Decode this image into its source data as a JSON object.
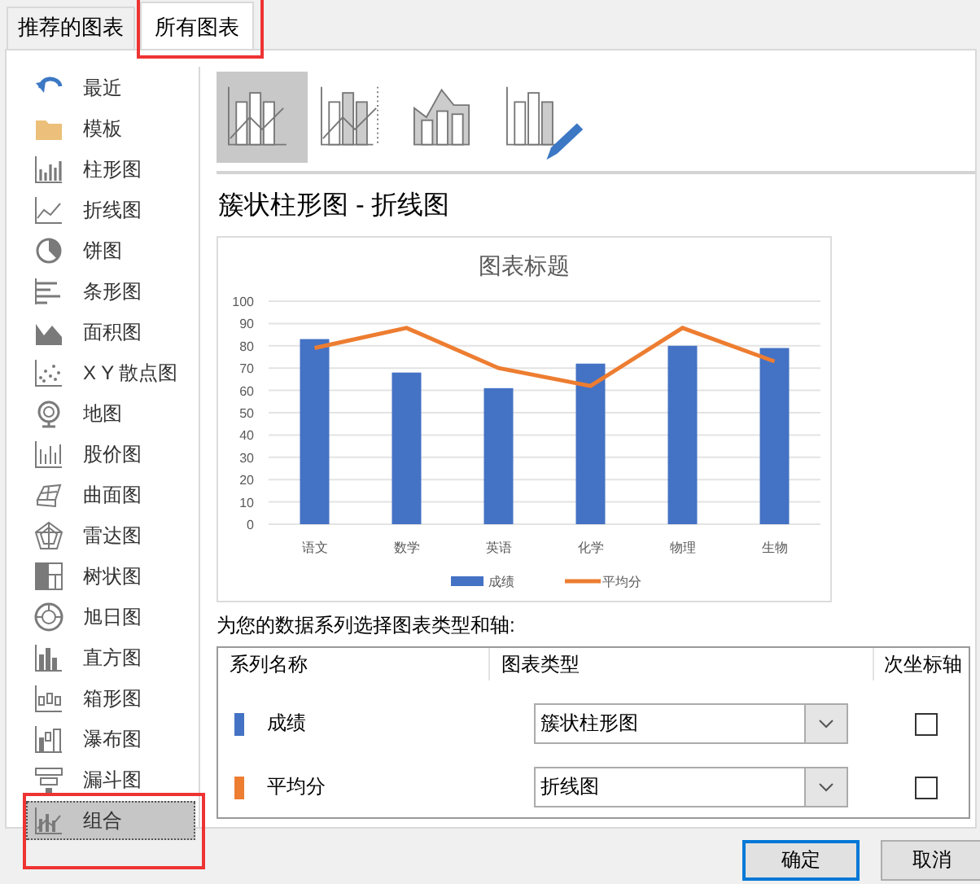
{
  "tabs": [
    {
      "label": "推荐的图表",
      "selected": false,
      "highlighted": false
    },
    {
      "label": "所有图表",
      "selected": true,
      "highlighted": true
    }
  ],
  "sidebar": {
    "items": [
      {
        "label": "最近",
        "selected": false,
        "highlighted": false
      },
      {
        "label": "模板",
        "selected": false,
        "highlighted": false
      },
      {
        "label": "柱形图",
        "selected": false,
        "highlighted": false
      },
      {
        "label": "折线图",
        "selected": false,
        "highlighted": false
      },
      {
        "label": "饼图",
        "selected": false,
        "highlighted": false
      },
      {
        "label": "条形图",
        "selected": false,
        "highlighted": false
      },
      {
        "label": "面积图",
        "selected": false,
        "highlighted": false
      },
      {
        "label": "X Y 散点图",
        "selected": false,
        "highlighted": false
      },
      {
        "label": "地图",
        "selected": false,
        "highlighted": false
      },
      {
        "label": "股价图",
        "selected": false,
        "highlighted": false
      },
      {
        "label": "曲面图",
        "selected": false,
        "highlighted": false
      },
      {
        "label": "雷达图",
        "selected": false,
        "highlighted": false
      },
      {
        "label": "树状图",
        "selected": false,
        "highlighted": false
      },
      {
        "label": "旭日图",
        "selected": false,
        "highlighted": false
      },
      {
        "label": "直方图",
        "selected": false,
        "highlighted": false
      },
      {
        "label": "箱形图",
        "selected": false,
        "highlighted": false
      },
      {
        "label": "瀑布图",
        "selected": false,
        "highlighted": false
      },
      {
        "label": "漏斗图",
        "selected": false,
        "highlighted": false
      },
      {
        "label": "组合",
        "selected": true,
        "highlighted": true
      }
    ]
  },
  "subtypes": [
    {
      "selected": true
    },
    {
      "selected": false
    },
    {
      "selected": false
    },
    {
      "selected": false
    }
  ],
  "chart_title": "簇状柱形图 - 折线图",
  "preview": {
    "chart_data": {
      "type": "bar",
      "title": "图表标题",
      "categories": [
        "语文",
        "数学",
        "英语",
        "化学",
        "物理",
        "生物"
      ],
      "series": [
        {
          "name": "成绩",
          "color": "#4472c4",
          "values": [
            83,
            68,
            61,
            72,
            80,
            79
          ]
        },
        {
          "name": "平均分",
          "color": "#ed7d31",
          "type": "line",
          "values": [
            79,
            88,
            70,
            62,
            88,
            73
          ]
        }
      ],
      "grid": true,
      "legend": "bottom",
      "ylim": [
        0,
        100
      ],
      "yticks": [
        0,
        10,
        20,
        30,
        40,
        50,
        60,
        70,
        80,
        90,
        100
      ]
    }
  },
  "series_prompt": "为您的数据系列选择图表类型和轴:",
  "series_table": {
    "columns": [
      "系列名称",
      "图表类型",
      "次坐标轴"
    ],
    "rows": [
      {
        "name": "成绩",
        "color": "#4472c4",
        "chart_type": "簇状柱形图",
        "secondary_axis": false
      },
      {
        "name": "平均分",
        "color": "#ed7d31",
        "chart_type": "折线图",
        "secondary_axis": false
      }
    ]
  },
  "buttons": [
    {
      "label": "确定",
      "default": true
    },
    {
      "label": "取消",
      "default": false
    }
  ]
}
